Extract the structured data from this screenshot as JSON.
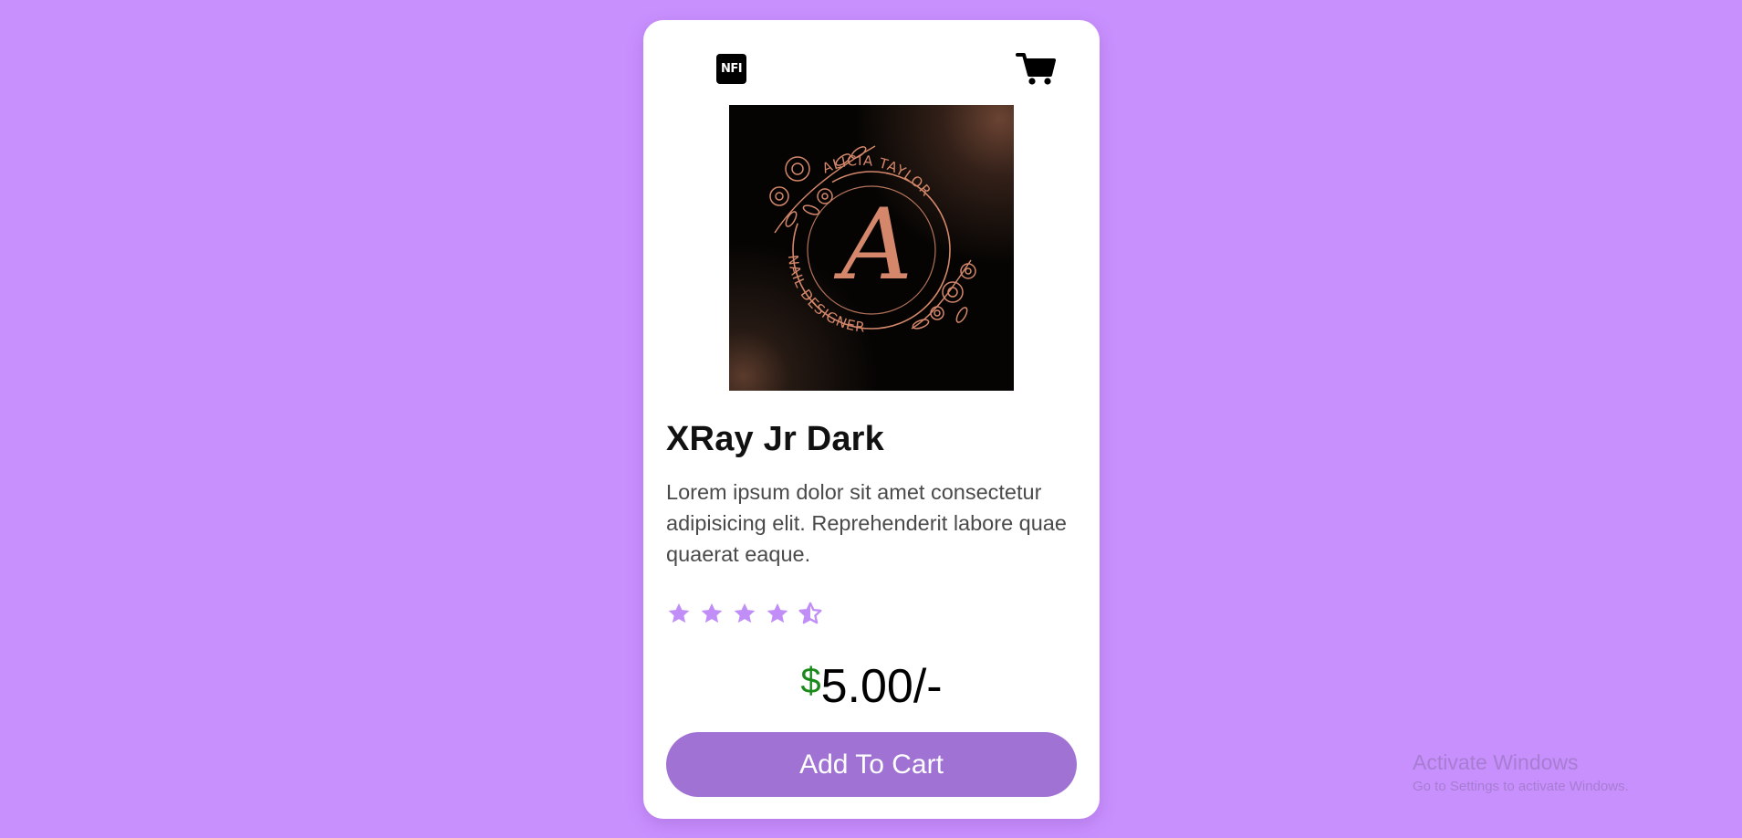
{
  "header": {
    "logo_text": "NFI",
    "cart_icon": "shopping-cart-icon"
  },
  "product": {
    "image_text": {
      "arc_top": "ALICIA TAYLOR",
      "arc_bottom": "NAIL DESIGNER",
      "monogram": "A"
    },
    "title": "XRay Jr Dark",
    "description": "Lorem ipsum dolor sit amet consectetur adipisicing elit. Reprehenderit labore quae quaerat eaque.",
    "rating": 4.5,
    "rating_max": 5,
    "price_currency": "$",
    "price_amount": "5.00/-",
    "add_button_label": "Add To Cart"
  },
  "watermark": {
    "title": "Activate Windows",
    "subtitle": "Go to Settings to activate Windows."
  },
  "colors": {
    "background": "#c890fd",
    "accent": "#a072d4",
    "star": "#c08ef6",
    "currency": "#1a8a1a",
    "logo_gold": "#d4876a"
  }
}
